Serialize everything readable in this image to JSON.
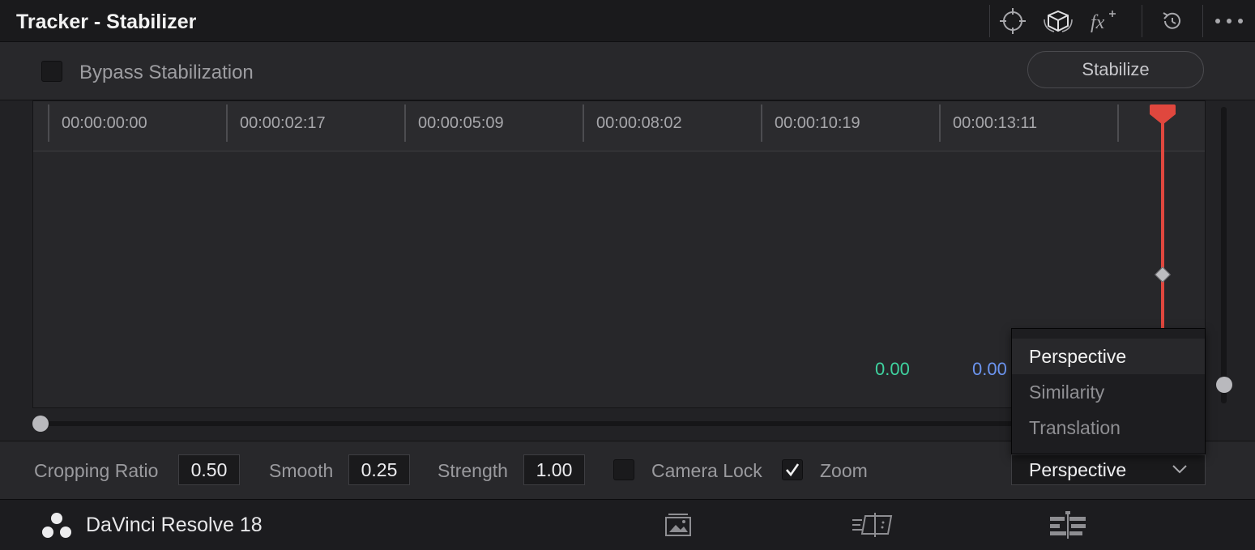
{
  "header": {
    "title": "Tracker - Stabilizer",
    "icons": [
      "target-icon",
      "3d-cube-icon",
      "fx-icon",
      "reset-icon",
      "more-icon"
    ]
  },
  "options": {
    "bypass_label": "Bypass Stabilization",
    "bypass_checked": false,
    "stabilize_label": "Stabilize"
  },
  "timeline": {
    "timecodes": [
      "00:00:00:00",
      "00:00:02:17",
      "00:00:05:09",
      "00:00:08:02",
      "00:00:10:19",
      "00:00:13:11"
    ],
    "value_green": "0.00",
    "value_blue": "0.00",
    "playhead_color": "#e0473e"
  },
  "menu": {
    "items": [
      "Perspective",
      "Similarity",
      "Translation"
    ],
    "selected": "Perspective"
  },
  "controls": {
    "cropping_ratio_label": "Cropping Ratio",
    "cropping_ratio_value": "0.50",
    "smooth_label": "Smooth",
    "smooth_value": "0.25",
    "strength_label": "Strength",
    "strength_value": "1.00",
    "camera_lock_label": "Camera Lock",
    "camera_lock_checked": false,
    "zoom_label": "Zoom",
    "zoom_checked": true,
    "mode_value": "Perspective"
  },
  "bottombar": {
    "app_name": "DaVinci Resolve 18",
    "icons": [
      "davinci-logo-icon",
      "media-page-icon",
      "cut-page-icon",
      "edit-page-icon"
    ]
  },
  "colors": {
    "accent_green": "#3fd3a0",
    "accent_blue": "#6c95f0",
    "playhead": "#e0473e"
  }
}
